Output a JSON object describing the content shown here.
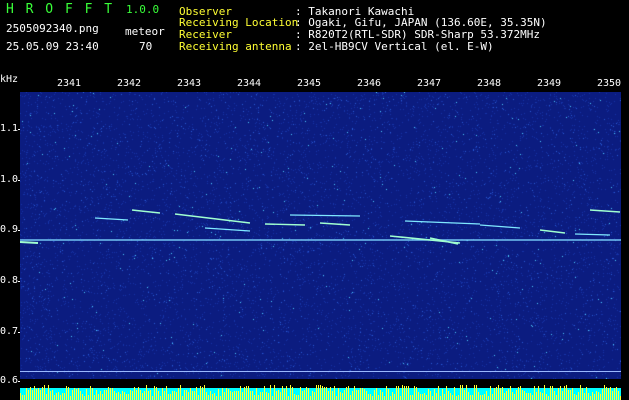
{
  "app": {
    "name": "H R O F F T",
    "version": "1.0.0"
  },
  "file": {
    "name": "2505092340.png",
    "datetime": "25.05.09 23:40"
  },
  "meteor": {
    "label": "meteor",
    "count": "70"
  },
  "station": {
    "observer_label": "Observer",
    "observer_value": ": Takanori Kawachi",
    "location_label": "Receiving Location",
    "location_value": ": Ogaki, Gifu, JAPAN (136.60E, 35.35N)",
    "receiver_label": "Receiver",
    "receiver_value": ": R820T2(RTL-SDR) SDR-Sharp 53.372MHz",
    "antenna_label": "Receiving antenna",
    "antenna_value": ": 2el-HB9CV Vertical (el. E-W)"
  },
  "axis": {
    "y_unit": "kHz",
    "y_ticks": [
      "1.1",
      "1.0",
      "0.9",
      "0.8",
      "0.7",
      "0.6"
    ],
    "x_ticks": [
      "2341",
      "2342",
      "2343",
      "2344",
      "2345",
      "2346",
      "2347",
      "2348",
      "2349",
      "2350"
    ]
  },
  "colors": {
    "background": "#0a1a7a",
    "trace": "#a0ffd0",
    "carrier": "#80e0ff",
    "header_green": "#39ff39",
    "bar_cyan": "#00ffff",
    "bar_yellow": "#ffff33"
  }
}
